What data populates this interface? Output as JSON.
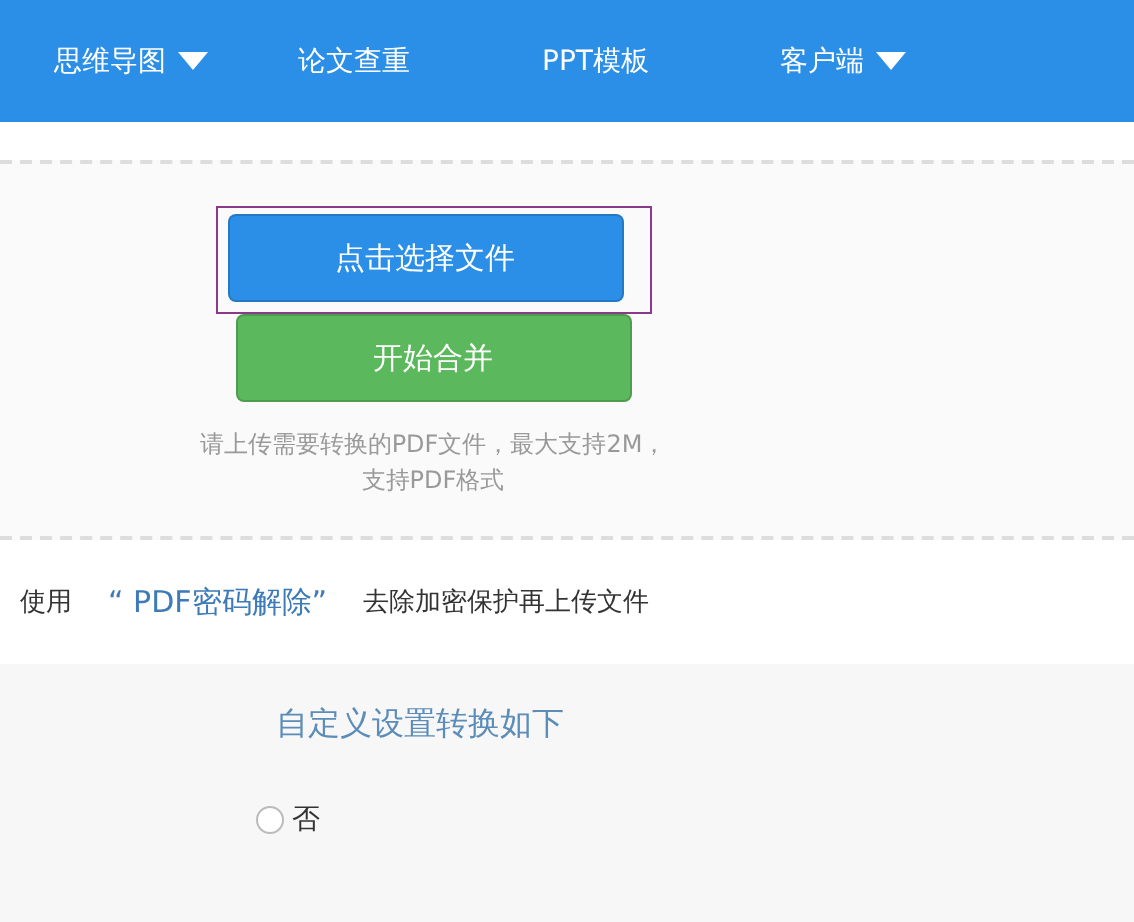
{
  "nav": {
    "items": [
      {
        "label": "思维导图",
        "dropdown": true
      },
      {
        "label": "论文查重",
        "dropdown": false
      },
      {
        "label": "PPT模板",
        "dropdown": false
      },
      {
        "label": "客户端",
        "dropdown": true
      }
    ]
  },
  "upload": {
    "select_button": "点击选择文件",
    "merge_button": "开始合并",
    "hint_lines": [
      "请上传需要转换的PDF文件，最大支持2M，",
      "支持PDF格式"
    ]
  },
  "notice": {
    "before": "使用",
    "link": "“ PDF密码解除”",
    "after": "去除加密保护再上传文件"
  },
  "settings": {
    "title": "自定义设置转换如下",
    "options": [
      {
        "label": "否",
        "selected": false
      }
    ]
  }
}
